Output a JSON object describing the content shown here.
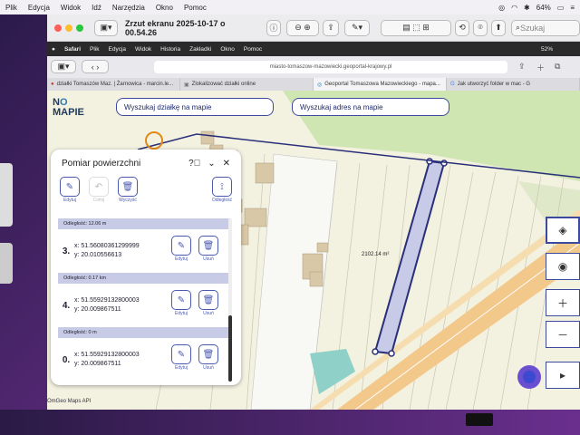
{
  "menubar": {
    "items": [
      "Plik",
      "Edycja",
      "Widok",
      "Idź",
      "Narzędzia",
      "Okno",
      "Pomoc"
    ],
    "battery": "64%"
  },
  "preview": {
    "title": "Zrzut ekranu 2025-10-17 o 00.54.26",
    "search_placeholder": "Szukaj"
  },
  "safari_menu": {
    "items": [
      "Safari",
      "Plik",
      "Edycja",
      "Widok",
      "Historia",
      "Zakładki",
      "Okno",
      "Pomoc"
    ],
    "battery": "52%"
  },
  "browser": {
    "url": "miasto-tomaszow-mazowiecki.geoportal-krajowy.pl",
    "tabs": [
      {
        "label": "działki Tomaszów Maz. | Żarnowica - marcin.le..."
      },
      {
        "label": "Zlokalizować działki online"
      },
      {
        "label": "Geoportal Tomaszowa Mazowieckiego - mapa..."
      },
      {
        "label": "Jak utworzyć folder w mac - G"
      }
    ]
  },
  "map": {
    "logo_line1": "N",
    "logo_o": "O",
    "logo_line2": "MAPIE",
    "search_parcel": "Wyszukaj działkę na mapie",
    "search_address": "Wyszukaj adres na mapie",
    "area_label": "2102.14 m²",
    "footer": "OmGeo Maps API"
  },
  "panel": {
    "title": "Pomiar powierzchni",
    "tools": {
      "edit": "Edytuj",
      "undo": "Cofnij",
      "clear": "Wyczyść",
      "distance": "Odległość"
    },
    "entries": [
      {
        "distance": "Odległość: 12.06 m",
        "num": "3.",
        "x": "x: 51.56080361299999",
        "y": "y: 20.010556613",
        "edit": "Edytuj",
        "delete": "Usuń"
      },
      {
        "distance": "Odległość: 0.17 km",
        "num": "4.",
        "x": "x: 51.55929132800003",
        "y": "y: 20.009867511",
        "edit": "Edytuj",
        "delete": "Usuń"
      },
      {
        "distance": "Odległość: 0 m",
        "num": "0.",
        "x": "x: 51.55929132800003",
        "y": "y: 20.009867511",
        "edit": "Edytuj",
        "delete": "Usuń"
      }
    ]
  },
  "colors": {
    "accent": "#3b4a9c",
    "parcel_fill": "#c7cbe8",
    "road": "#f3c98b",
    "green_area": "#cde8b0"
  }
}
